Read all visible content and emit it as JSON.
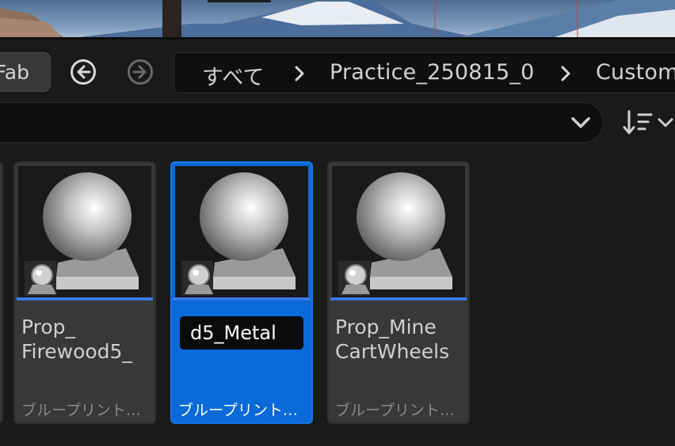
{
  "toolbar": {
    "fab_label": "Fab",
    "back_icon": "arrow-left-circle-icon",
    "forward_icon": "arrow-right-circle-icon",
    "breadcrumbs": [
      "すべて",
      "Practice_250815_0",
      "Custom"
    ],
    "separator_icon": "chevron-right-icon"
  },
  "search": {
    "value": "",
    "dropdown_icon": "chevron-down-icon",
    "sort_icon": "sort-filter-icon"
  },
  "assets": [
    {
      "name": "Prop_\nFirewood5_",
      "type": "ブループリント…",
      "selected": false,
      "thumbnail_icon": "material-sphere-icon"
    },
    {
      "name": "d5_Metal",
      "type": "ブループリント…",
      "selected": true,
      "renaming": true,
      "thumbnail_icon": "material-sphere-icon"
    },
    {
      "name": "Prop_Mine\nCartWheels",
      "type": "ブループリント…",
      "selected": false,
      "thumbnail_icon": "material-sphere-icon"
    }
  ],
  "colors": {
    "background": "#1a1a1a",
    "tile": "#383838",
    "selected": "#0a6ad9",
    "asset_type_bar": "#3c78e8"
  }
}
